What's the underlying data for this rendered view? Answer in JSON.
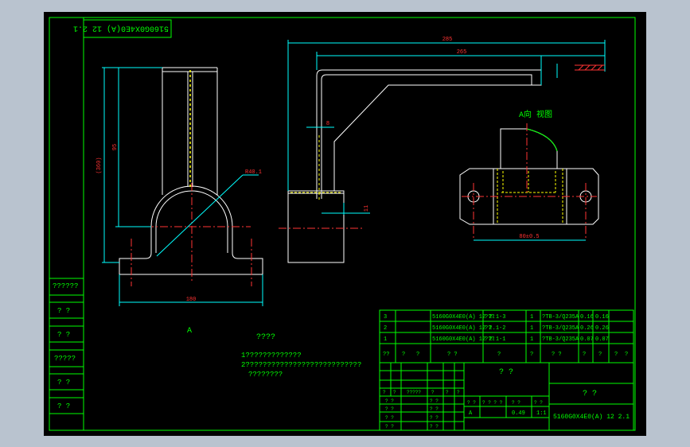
{
  "colors": {
    "background": "#b9c3cf",
    "sheet": "#000000",
    "frame": "#00ff00",
    "outline": "#ffffff",
    "dimension": "#00ffff",
    "centerline": "#ff0000",
    "hidden": "#ffff00",
    "text": "#00ff00",
    "red_text": "#ff3333"
  },
  "drawing_number_top": "5160G0X4E0(A) 12 2.1",
  "dimensions": {
    "overall_width": "285",
    "inner_width": "265",
    "height_total": "(360)",
    "height_inner": "95",
    "radius": "R40.1",
    "leg_width": "8",
    "bottom_gap": "11",
    "base_width": "180",
    "hole_spacing": "80±0.5"
  },
  "views": {
    "front_label": "A",
    "aux_view_label": "A向 视图"
  },
  "notes": {
    "heading": "????",
    "line1": "1?????????????",
    "line2": "2???????????????????????????",
    "line3": "????????"
  },
  "left_column": [
    "??????",
    "? ?",
    "? ?",
    "?????",
    "? ?",
    "? ?"
  ],
  "bom": [
    {
      "no": "3",
      "code": "5160G0X4E0(A) 12 2.1-3",
      "name": "???",
      "qty": "1",
      "material": "?TB-3/Q235A",
      "w1": "0.16",
      "w2": "0.16"
    },
    {
      "no": "2",
      "code": "5160G0X4E0(A) 12 2.1-2",
      "name": "??",
      "qty": "1",
      "material": "?TB-3/Q235A",
      "w1": "0.26",
      "w2": "0.26"
    },
    {
      "no": "1",
      "code": "5160G0X4E0(A) 12 2.1-1",
      "name": "???",
      "qty": "1",
      "material": "?TB-3/Q235A",
      "w1": "0.07",
      "w2": "0.07"
    }
  ],
  "bom_header": [
    "??",
    "?",
    "?",
    "? ?",
    "?",
    "?",
    "? ?",
    "?",
    "?",
    "?",
    "?"
  ],
  "title_block": {
    "part_name": "? ?",
    "company": "? ?",
    "drawing_number": "5160G0X4E0(A) 12 2.1",
    "stage_label": "A",
    "weight": "0.49",
    "scale": "1:1",
    "rev_labels": [
      "?",
      "?",
      "?????",
      "?",
      "?",
      "?"
    ],
    "sign_labels": [
      "? ?",
      "? ?",
      "? ?",
      "? ?"
    ],
    "stage_header": [
      "? ?",
      "? ? ? ?",
      "? ?",
      "? ?"
    ]
  }
}
